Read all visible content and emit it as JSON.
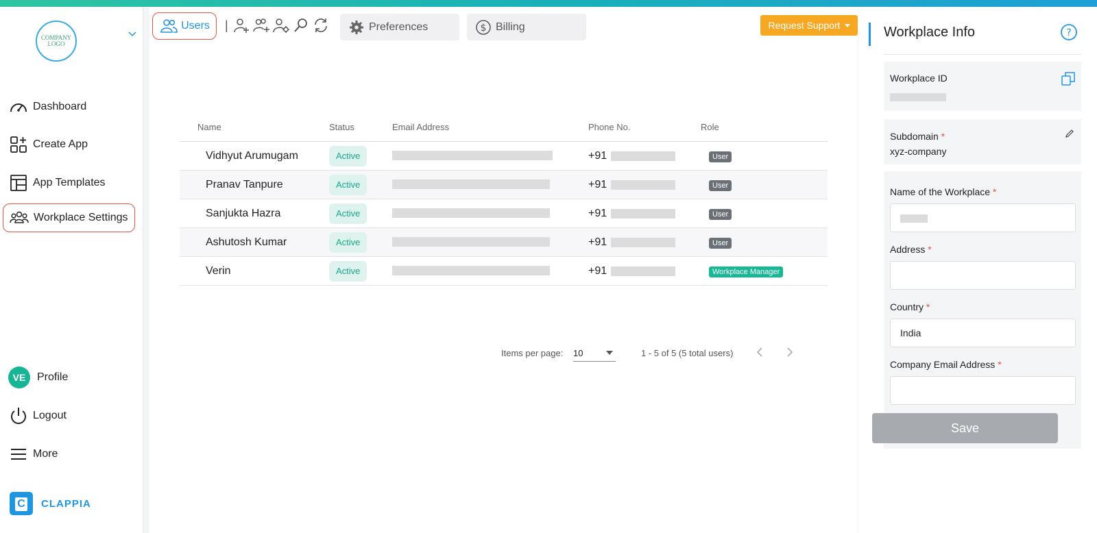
{
  "sidebar": {
    "logo_text": "COMPANY LOGO",
    "items": [
      {
        "label": "Dashboard"
      },
      {
        "label": "Create App"
      },
      {
        "label": "App Templates"
      },
      {
        "label": "Workplace Settings"
      }
    ],
    "profile": {
      "initials": "VE",
      "label": "Profile"
    },
    "logout_label": "Logout",
    "more_label": "More",
    "brand": "CLAPPIA"
  },
  "tabs": {
    "users": "Users",
    "separator": "|",
    "preferences": "Preferences",
    "billing": "Billing"
  },
  "header": {
    "request_support": "Request Support"
  },
  "table": {
    "columns": [
      "Name",
      "Status",
      "Email Address",
      "Phone No.",
      "Role"
    ],
    "rows": [
      {
        "name": "Vidhyut Arumugam",
        "status": "Active",
        "phone_prefix": "+91",
        "role": "User"
      },
      {
        "name": "Pranav Tanpure",
        "status": "Active",
        "phone_prefix": "+91",
        "role": "User"
      },
      {
        "name": "Sanjukta Hazra",
        "status": "Active",
        "phone_prefix": "+91",
        "role": "User"
      },
      {
        "name": "Ashutosh Kumar",
        "status": "Active",
        "phone_prefix": "+91",
        "role": "User"
      },
      {
        "name": "Verin",
        "status": "Active",
        "phone_prefix": "+91",
        "role": "Workplace Manager"
      }
    ]
  },
  "pagination": {
    "items_per_page_label": "Items per page:",
    "items_per_page": "10",
    "range": "1 - 5 of 5 (5 total users)"
  },
  "panel": {
    "title": "Workplace Info",
    "workplace_id_label": "Workplace ID",
    "subdomain_label": "Subdomain",
    "subdomain_value": "xyz-company",
    "name_label": "Name of the Workplace",
    "address_label": "Address",
    "country_label": "Country",
    "country_value": "India",
    "email_label": "Company Email Address",
    "required_mark": "*",
    "save_label": "Save"
  },
  "colors": {
    "accent": "#2196e0",
    "active_outline": "#e8533f",
    "support_button": "#f7a823",
    "status_green": "#17a88c"
  }
}
